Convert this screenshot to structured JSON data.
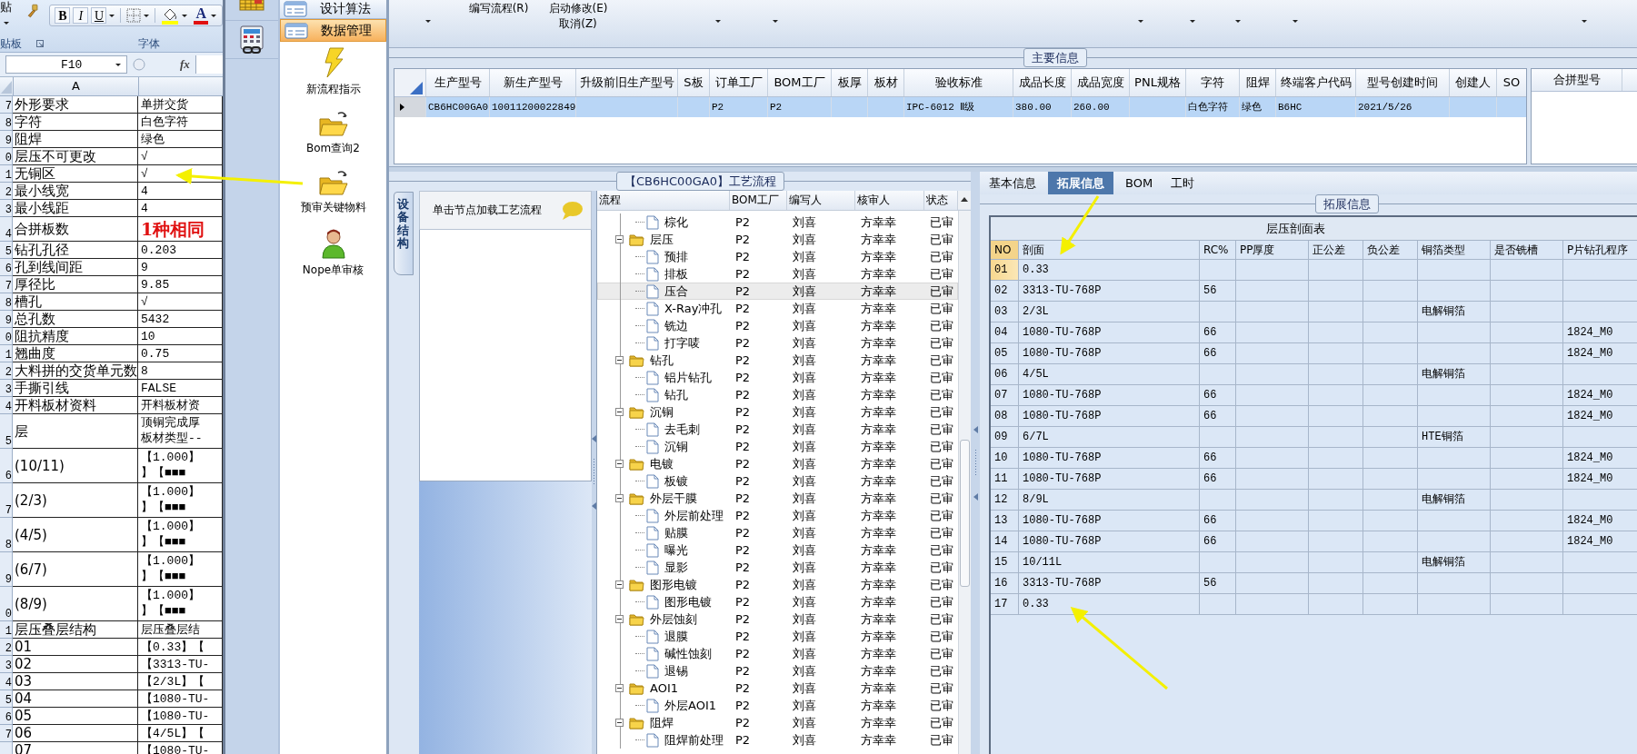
{
  "excel": {
    "ribbon": {
      "paste_label": "贴",
      "clipboard_label": "贴板",
      "font_group_label": "字体",
      "format_buttons": [
        {
          "label": "B",
          "kind": "bold"
        },
        {
          "label": "I",
          "kind": "italic"
        },
        {
          "label": "U",
          "kind": "underline"
        }
      ],
      "font_color_label": "A"
    },
    "name_box": "F10",
    "formula_label": "fx",
    "column_header": "A",
    "rows": [
      {
        "row_number": "7",
        "label": "外形要求",
        "value": "单拼交货",
        "kind": "normal"
      },
      {
        "row_number": "8",
        "label": "字符",
        "value": "白色字符",
        "kind": "normal"
      },
      {
        "row_number": "9",
        "label": "阻焊",
        "value": "绿色",
        "kind": "normal"
      },
      {
        "row_number": "0",
        "label": "层压不可更改",
        "value": "√",
        "kind": "normal"
      },
      {
        "row_number": "1",
        "label": "无铜区",
        "value": "√",
        "kind": "normal"
      },
      {
        "row_number": "2",
        "label": "最小线宽",
        "value": "4",
        "kind": "normal"
      },
      {
        "row_number": "3",
        "label": "最小线距",
        "value": "4",
        "kind": "normal"
      },
      {
        "row_number": "4",
        "label": "合拼板数",
        "value": "1种相同",
        "kind": "emphasis"
      },
      {
        "row_number": "5",
        "label": "钻孔孔径",
        "value": "0.203",
        "kind": "normal"
      },
      {
        "row_number": "6",
        "label": "孔到线间距",
        "value": "9",
        "kind": "normal"
      },
      {
        "row_number": "7",
        "label": "厚径比",
        "value": "9.85",
        "kind": "normal"
      },
      {
        "row_number": "8",
        "label": "槽孔",
        "value": "√",
        "kind": "normal"
      },
      {
        "row_number": "9",
        "label": "总孔数",
        "value": "5432",
        "kind": "normal"
      },
      {
        "row_number": "0",
        "label": "阻抗精度",
        "value": "10",
        "kind": "normal"
      },
      {
        "row_number": "1",
        "label": "翘曲度",
        "value": "0.75",
        "kind": "normal"
      },
      {
        "row_number": "2",
        "label": "大料拼的交货单元数",
        "value": "8",
        "kind": "normal"
      },
      {
        "row_number": "3",
        "label": "手撕引线",
        "value": "FALSE",
        "kind": "normal"
      },
      {
        "row_number": "4",
        "label": "开料板材资料",
        "value": "开料板材资",
        "kind": "normal"
      },
      {
        "row_number": "5",
        "label": "层",
        "value_lines": [
          "顶铜完成厚",
          "板材类型--"
        ],
        "kind": "double"
      },
      {
        "row_number": "6",
        "label": "(10/11)",
        "value_lines": [
          "【1.000】",
          "】【■■■"
        ],
        "kind": "double"
      },
      {
        "row_number": "7",
        "label": "(2/3)",
        "value_lines": [
          "【1.000】",
          "】【■■■"
        ],
        "kind": "double"
      },
      {
        "row_number": "8",
        "label": "(4/5)",
        "value_lines": [
          "【1.000】",
          "】【■■■"
        ],
        "kind": "double"
      },
      {
        "row_number": "9",
        "label": "(6/7)",
        "value_lines": [
          "【1.000】",
          "】【■■■"
        ],
        "kind": "double"
      },
      {
        "row_number": "0",
        "label": "(8/9)",
        "value_lines": [
          "【1.000】",
          "】【■■■"
        ],
        "kind": "double"
      },
      {
        "row_number": "1",
        "label": "层压叠层结构",
        "value": "层压叠层结",
        "kind": "normal"
      },
      {
        "row_number": "2",
        "label": "01",
        "value": "【0.33】【",
        "kind": "normal"
      },
      {
        "row_number": "3",
        "label": "02",
        "value": "【3313-TU-",
        "kind": "normal"
      },
      {
        "row_number": "4",
        "label": "03",
        "value": "【2/3L】【",
        "kind": "normal"
      },
      {
        "row_number": "5",
        "label": "04",
        "value": "【1080-TU-",
        "kind": "normal"
      },
      {
        "row_number": "6",
        "label": "05",
        "value": "【1080-TU-",
        "kind": "normal"
      },
      {
        "row_number": "7",
        "label": "06",
        "value": "【4/5L】【",
        "kind": "normal"
      },
      {
        "label": "07",
        "value": "【1080-TU-",
        "kind": "normal"
      }
    ]
  },
  "nav": {
    "groups": [
      {
        "label": "设计算法",
        "selected": false
      },
      {
        "label": "数据管理",
        "selected": true
      }
    ],
    "commands": [
      {
        "label": "新流程指示",
        "kind": "lightning"
      },
      {
        "label": "Bom查询2",
        "kind": "folder"
      },
      {
        "label": "预审关键物料",
        "kind": "folder"
      },
      {
        "label": "Nope单审核",
        "kind": "person"
      }
    ]
  },
  "toolbar": {
    "items": [
      {
        "dropdown": true
      },
      {
        "lines": [
          "编写流程(R)"
        ],
        "dropdown": false
      },
      {
        "lines": [
          "启动修改(E)",
          "取消(Z)"
        ],
        "dropdown": false
      },
      {
        "dropdown": true
      },
      {
        "dropdown": true
      },
      {
        "dropdown": true
      },
      {
        "dropdown": true
      },
      {
        "dropdown": true
      },
      {
        "dropdown": true
      },
      {
        "dropdown": true
      }
    ]
  },
  "main_info": {
    "title": "主要信息",
    "columns": [
      "生产型号",
      "新生产型号",
      "升级前旧生产型号",
      "S板",
      "订单工厂",
      "BOM工厂",
      "板厚",
      "板材",
      "验收标准",
      "成品长度",
      "成品宽度",
      "PNL规格",
      "字符",
      "阻焊",
      "终端客户代码",
      "型号创建时间",
      "创建人",
      "SO"
    ],
    "rows": [
      {
        "selected": true,
        "cells": [
          "CB6HC00GA0",
          "10011200022849",
          null,
          null,
          "P2",
          "P2",
          null,
          null,
          "IPC-6012 Ⅱ级",
          "380.00",
          "260.00",
          null,
          "白色字符",
          "绿色",
          "B6HC",
          "2021/5/26",
          null,
          null
        ]
      }
    ],
    "merge_panel": {
      "columns": [
        "合拼型号"
      ]
    }
  },
  "process": {
    "title": "【CB6HC00GA0】工艺流程",
    "side_tab": "设备结构",
    "hint": "单击节点加载工艺流程",
    "tree": {
      "columns": [
        "流程",
        "BOM工厂",
        "编写人",
        "核审人",
        "状态"
      ],
      "nodes": [
        {
          "children": [
            {
              "label": "棕化",
              "bom": "P2",
              "writer": "刘喜",
              "reviewer": "方幸幸",
              "status": "已审",
              "selected": false
            }
          ]
        },
        {
          "label": "层压",
          "bom": "P2",
          "writer": "刘喜",
          "reviewer": "方幸幸",
          "status": "已审",
          "selected": false,
          "expanded": true,
          "children": [
            {
              "label": "预排",
              "bom": "P2",
              "writer": "刘喜",
              "reviewer": "方幸幸",
              "status": "已审",
              "selected": false
            },
            {
              "label": "排板",
              "bom": "P2",
              "writer": "刘喜",
              "reviewer": "方幸幸",
              "status": "已审",
              "selected": false
            },
            {
              "label": "压合",
              "bom": "P2",
              "writer": "刘喜",
              "reviewer": "方幸幸",
              "status": "已审",
              "selected": true
            },
            {
              "label": "X-Ray冲孔",
              "bom": "P2",
              "writer": "刘喜",
              "reviewer": "方幸幸",
              "status": "已审",
              "selected": false
            },
            {
              "label": "铣边",
              "bom": "P2",
              "writer": "刘喜",
              "reviewer": "方幸幸",
              "status": "已审",
              "selected": false
            },
            {
              "label": "打字唛",
              "bom": "P2",
              "writer": "刘喜",
              "reviewer": "方幸幸",
              "status": "已审",
              "selected": false
            }
          ]
        },
        {
          "label": "钻孔",
          "bom": "P2",
          "writer": "刘喜",
          "reviewer": "方幸幸",
          "status": "已审",
          "selected": false,
          "expanded": true,
          "children": [
            {
              "label": "铝片钻孔",
              "bom": "P2",
              "writer": "刘喜",
              "reviewer": "方幸幸",
              "status": "已审",
              "selected": false
            },
            {
              "label": "钻孔",
              "bom": "P2",
              "writer": "刘喜",
              "reviewer": "方幸幸",
              "status": "已审",
              "selected": false
            }
          ]
        },
        {
          "label": "沉铜",
          "bom": "P2",
          "writer": "刘喜",
          "reviewer": "方幸幸",
          "status": "已审",
          "selected": false,
          "expanded": true,
          "children": [
            {
              "label": "去毛刺",
              "bom": "P2",
              "writer": "刘喜",
              "reviewer": "方幸幸",
              "status": "已审",
              "selected": false
            },
            {
              "label": "沉铜",
              "bom": "P2",
              "writer": "刘喜",
              "reviewer": "方幸幸",
              "status": "已审",
              "selected": false
            }
          ]
        },
        {
          "label": "电镀",
          "bom": "P2",
          "writer": "刘喜",
          "reviewer": "方幸幸",
          "status": "已审",
          "selected": false,
          "expanded": true,
          "children": [
            {
              "label": "板镀",
              "bom": "P2",
              "writer": "刘喜",
              "reviewer": "方幸幸",
              "status": "已审",
              "selected": false
            }
          ]
        },
        {
          "label": "外层干膜",
          "bom": "P2",
          "writer": "刘喜",
          "reviewer": "方幸幸",
          "status": "已审",
          "selected": false,
          "expanded": true,
          "children": [
            {
              "label": "外层前处理",
              "bom": "P2",
              "writer": "刘喜",
              "reviewer": "方幸幸",
              "status": "已审",
              "selected": false
            },
            {
              "label": "贴膜",
              "bom": "P2",
              "writer": "刘喜",
              "reviewer": "方幸幸",
              "status": "已审",
              "selected": false
            },
            {
              "label": "曝光",
              "bom": "P2",
              "writer": "刘喜",
              "reviewer": "方幸幸",
              "status": "已审",
              "selected": false
            },
            {
              "label": "显影",
              "bom": "P2",
              "writer": "刘喜",
              "reviewer": "方幸幸",
              "status": "已审",
              "selected": false
            }
          ]
        },
        {
          "label": "图形电镀",
          "bom": "P2",
          "writer": "刘喜",
          "reviewer": "方幸幸",
          "status": "已审",
          "selected": false,
          "expanded": true,
          "children": [
            {
              "label": "图形电镀",
              "bom": "P2",
              "writer": "刘喜",
              "reviewer": "方幸幸",
              "status": "已审",
              "selected": false
            }
          ]
        },
        {
          "label": "外层蚀刻",
          "bom": "P2",
          "writer": "刘喜",
          "reviewer": "方幸幸",
          "status": "已审",
          "selected": false,
          "expanded": true,
          "children": [
            {
              "label": "退膜",
              "bom": "P2",
              "writer": "刘喜",
              "reviewer": "方幸幸",
              "status": "已审",
              "selected": false
            },
            {
              "label": "碱性蚀刻",
              "bom": "P2",
              "writer": "刘喜",
              "reviewer": "方幸幸",
              "status": "已审",
              "selected": false
            },
            {
              "label": "退锡",
              "bom": "P2",
              "writer": "刘喜",
              "reviewer": "方幸幸",
              "status": "已审",
              "selected": false
            }
          ]
        },
        {
          "label": "AOI1",
          "bom": "P2",
          "writer": "刘喜",
          "reviewer": "方幸幸",
          "status": "已审",
          "selected": false,
          "expanded": true,
          "children": [
            {
              "label": "外层AOI1",
              "bom": "P2",
              "writer": "刘喜",
              "reviewer": "方幸幸",
              "status": "已审",
              "selected": false
            }
          ]
        },
        {
          "label": "阻焊",
          "bom": "P2",
          "writer": "刘喜",
          "reviewer": "方幸幸",
          "status": "已审",
          "selected": false,
          "expanded": true,
          "children": [
            {
              "label": "阻焊前处理",
              "bom": "P2",
              "writer": "刘喜",
              "reviewer": "方幸幸",
              "status": "已审",
              "selected": false
            }
          ]
        }
      ]
    }
  },
  "detail": {
    "tabs": [
      {
        "label": "基本信息",
        "selected": false
      },
      {
        "label": "拓展信息",
        "selected": true
      },
      {
        "label": "BOM",
        "selected": false
      },
      {
        "label": "工时",
        "selected": false
      }
    ],
    "group_title": "拓展信息",
    "table": {
      "title": "层压剖面表",
      "columns": [
        "NO",
        "剖面",
        "RC%",
        "PP厚度",
        "正公差",
        "负公差",
        "铜箔类型",
        "是否铣槽",
        "P片钻孔程序"
      ],
      "rows": [
        {
          "selected": true,
          "cells": [
            "01",
            "0.33",
            null,
            null,
            null,
            null,
            null,
            null,
            null
          ]
        },
        {
          "selected": false,
          "cells": [
            "02",
            "3313-TU-768P",
            "56",
            null,
            null,
            null,
            null,
            null,
            null
          ]
        },
        {
          "selected": false,
          "cells": [
            "03",
            "2/3L",
            null,
            null,
            null,
            null,
            "电解铜箔",
            null,
            null
          ]
        },
        {
          "selected": false,
          "cells": [
            "04",
            "1080-TU-768P",
            "66",
            null,
            null,
            null,
            null,
            null,
            "1824_M0"
          ]
        },
        {
          "selected": false,
          "cells": [
            "05",
            "1080-TU-768P",
            "66",
            null,
            null,
            null,
            null,
            null,
            "1824_M0"
          ]
        },
        {
          "selected": false,
          "cells": [
            "06",
            "4/5L",
            null,
            null,
            null,
            null,
            "电解铜箔",
            null,
            null
          ]
        },
        {
          "selected": false,
          "cells": [
            "07",
            "1080-TU-768P",
            "66",
            null,
            null,
            null,
            null,
            null,
            "1824_M0"
          ]
        },
        {
          "selected": false,
          "cells": [
            "08",
            "1080-TU-768P",
            "66",
            null,
            null,
            null,
            null,
            null,
            "1824_M0"
          ]
        },
        {
          "selected": false,
          "cells": [
            "09",
            "6/7L",
            null,
            null,
            null,
            null,
            "HTE铜箔",
            null,
            null
          ]
        },
        {
          "selected": false,
          "cells": [
            "10",
            "1080-TU-768P",
            "66",
            null,
            null,
            null,
            null,
            null,
            "1824_M0"
          ]
        },
        {
          "selected": false,
          "cells": [
            "11",
            "1080-TU-768P",
            "66",
            null,
            null,
            null,
            null,
            null,
            "1824_M0"
          ]
        },
        {
          "selected": false,
          "cells": [
            "12",
            "8/9L",
            null,
            null,
            null,
            null,
            "电解铜箔",
            null,
            null
          ]
        },
        {
          "selected": false,
          "cells": [
            "13",
            "1080-TU-768P",
            "66",
            null,
            null,
            null,
            null,
            null,
            "1824_M0"
          ]
        },
        {
          "selected": false,
          "cells": [
            "14",
            "1080-TU-768P",
            "66",
            null,
            null,
            null,
            null,
            null,
            "1824_M0"
          ]
        },
        {
          "selected": false,
          "cells": [
            "15",
            "10/11L",
            null,
            null,
            null,
            null,
            "电解铜箔",
            null,
            null
          ]
        },
        {
          "selected": false,
          "cells": [
            "16",
            "3313-TU-768P",
            "56",
            null,
            null,
            null,
            null,
            null,
            null
          ]
        },
        {
          "selected": false,
          "cells": [
            "17",
            "0.33",
            null,
            null,
            null,
            null,
            null,
            null,
            null
          ]
        }
      ]
    }
  }
}
